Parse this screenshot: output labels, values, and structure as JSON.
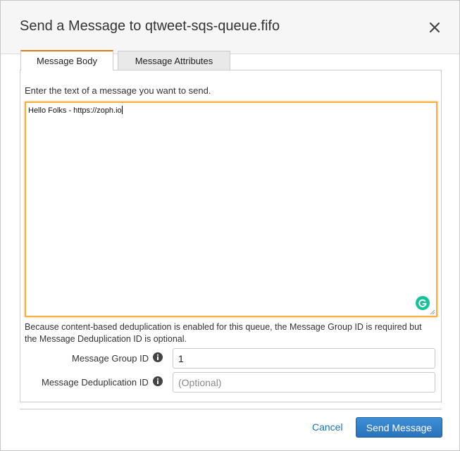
{
  "dialog": {
    "title": "Send a Message to qtweet-sqs-queue.fifo",
    "close_icon": "close-icon"
  },
  "tabs": [
    {
      "label": "Message Body",
      "active": true
    },
    {
      "label": "Message Attributes",
      "active": false
    }
  ],
  "body": {
    "instruction": "Enter the text of a message you want to send.",
    "message_text": "Hello Folks - https://zoph.io",
    "grammarly_icon": "grammarly-icon"
  },
  "dedup_note": "Because content-based deduplication is enabled for this queue, the Message Group ID is required but the Message Deduplication ID is optional.",
  "fields": {
    "group_id": {
      "label": "Message Group ID",
      "value": "1",
      "icon": "info-icon"
    },
    "dedup_id": {
      "label": "Message Deduplication ID",
      "value": "",
      "placeholder": "(Optional)",
      "icon": "info-icon"
    }
  },
  "footer": {
    "cancel_label": "Cancel",
    "send_label": "Send Message"
  },
  "colors": {
    "active_tab_accent": "#e07b13",
    "focus_border": "#f5b041",
    "primary_button": "#2a72bb",
    "link": "#1a73b5",
    "grammarly": "#15c39a"
  }
}
